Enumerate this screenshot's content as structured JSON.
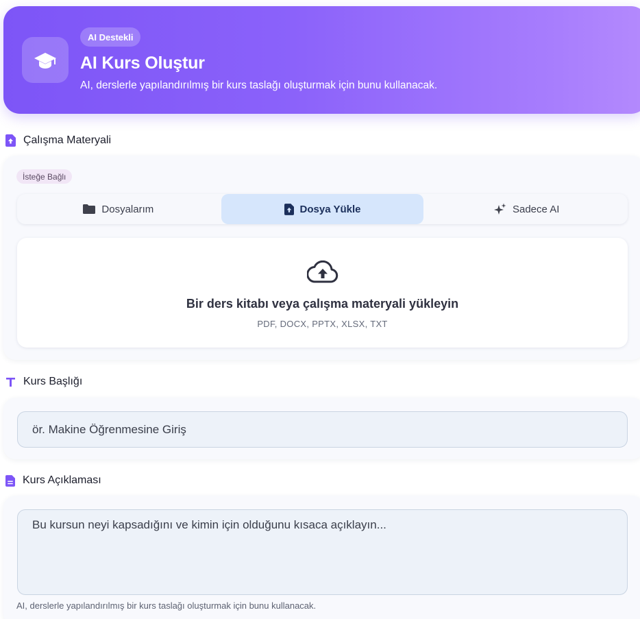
{
  "header": {
    "badge": "AI Destekli",
    "title": "AI Kurs Oluştur",
    "subtitle": "AI, derslerle yapılandırılmış bir kurs taslağı oluşturmak için bunu kullanacak.",
    "icon": "graduation-cap-icon"
  },
  "material": {
    "label": "Çalışma Materyali",
    "optional_badge": "İsteğe Bağlı",
    "tabs": [
      {
        "label": "Dosyalarım",
        "icon": "folder-icon",
        "active": false
      },
      {
        "label": "Dosya Yükle",
        "icon": "file-upload-icon",
        "active": true
      },
      {
        "label": "Sadece AI",
        "icon": "sparkle-icon",
        "active": false
      }
    ],
    "upload": {
      "title": "Bir ders kitabı veya çalışma materyali yükleyin",
      "formats": "PDF, DOCX, PPTX, XLSX, TXT",
      "icon": "cloud-upload-icon"
    }
  },
  "course_title": {
    "label": "Kurs Başlığı",
    "placeholder": "ör. Makine Öğrenmesine Giriş"
  },
  "course_description": {
    "label": "Kurs Açıklaması",
    "placeholder": "Bu kursun neyi kapsadığını ve kimin için olduğunu kısaca açıklayın...",
    "help": "AI, derslerle yapılandırılmış bir kurs taslağı oluşturmak için bunu kullanacak."
  },
  "colors": {
    "accent": "#7d55f7",
    "active_tab": "#d6e6fc",
    "card_bg": "#f8f9fd"
  }
}
